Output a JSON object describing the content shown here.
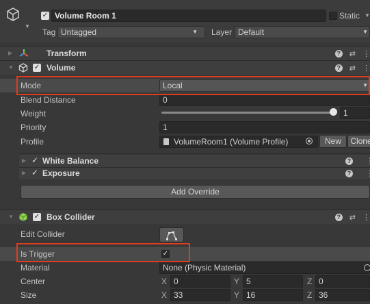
{
  "gameobject": {
    "name": "Volume Room 1",
    "static_label": "Static",
    "tag_label": "Tag",
    "tag_value": "Untagged",
    "layer_label": "Layer",
    "layer_value": "Default"
  },
  "transform": {
    "title": "Transform"
  },
  "volume": {
    "title": "Volume",
    "mode_label": "Mode",
    "mode_value": "Local",
    "blend_label": "Blend Distance",
    "blend_value": "0",
    "weight_label": "Weight",
    "weight_value": "1",
    "weight_fraction": 1.0,
    "priority_label": "Priority",
    "priority_value": "1",
    "profile_label": "Profile",
    "profile_value": "VolumeRoom1 (Volume Profile)",
    "new_label": "New",
    "clone_label": "Clone",
    "overrides": [
      "White Balance",
      "Exposure"
    ],
    "add_override_label": "Add Override"
  },
  "box_collider": {
    "title": "Box Collider",
    "edit_label": "Edit Collider",
    "trigger_label": "Is Trigger",
    "material_label": "Material",
    "material_value": "None (Physic Material)",
    "center_label": "Center",
    "center": {
      "x": "0",
      "y": "5",
      "z": "0"
    },
    "size_label": "Size",
    "size": {
      "x": "33",
      "y": "16",
      "z": "36"
    }
  },
  "colors": {
    "highlight": "#e03c1f",
    "background": "#383838",
    "header": "#3e3e3e"
  },
  "icons": [
    "gameobject-cube-icon",
    "transform-axis-icon",
    "volume-cube-icon",
    "box-collider-icon",
    "help-icon",
    "presets-icon",
    "menu-dots-icon",
    "edit-collider-icon",
    "object-picker-icon",
    "check-icon",
    "foldout-arrow-icon"
  ]
}
